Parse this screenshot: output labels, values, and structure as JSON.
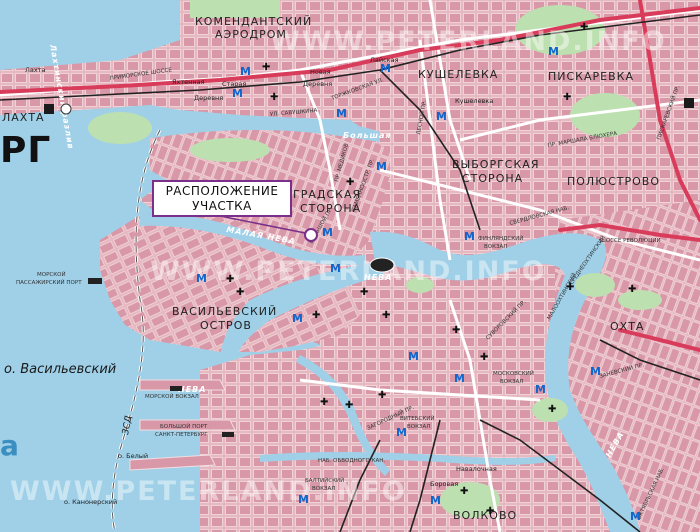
{
  "city_label": "РГ",
  "callout": {
    "line1": "РАСПОЛОЖЕНИЕ",
    "line2": "УЧАСТКА"
  },
  "watermark": "WWW.PETERLAND.INFO",
  "districts": {
    "komendantsky": "КОМЕНДАНТСКИЙ",
    "aerodrom": "АЭРОДРОМ",
    "kusheleveka": "КУШЕЛЕВКА",
    "piskarevka": "ПИСКАРЕВКА",
    "vyborg1": "ВЫБОРГСКАЯ",
    "vyborg2": "СТОРОНА",
    "polyustrovo": "ПОЛЮСТРОВО",
    "petrograd1": "ГРАДСКАЯ",
    "petrograd2": "СТОРОНА",
    "vasil1": "ВАСИЛЬЕВСКИЙ",
    "vasil2": "ОСТРОВ",
    "okhta": "ОХТА",
    "volkovo": "ВОЛКОВО",
    "lakhta": "ЛАХТА",
    "lakhta_top": "Лахта"
  },
  "places": {
    "yakhtennaya": "Яхтенная",
    "staraya1": "Старая",
    "staraya2": "Деревня",
    "novaya1": "Новая",
    "novaya2": "Деревня",
    "kushelevka": "Кушелевка",
    "laiskaya": "Лайская"
  },
  "islands": {
    "vasilievsky": "о. Васильевский",
    "bely": "о. Белый",
    "kanonersky": "о. Канонерский"
  },
  "water": {
    "neva1": "НЕВА",
    "neva2": "НЕВА",
    "neva3": "НЕВА",
    "malaya_neva": "МАЛАЯ НЕВА",
    "bolshaya": "Большая",
    "lakhtinsky": "Лахтинский разлив",
    "gulf": "а"
  },
  "labels": {
    "morskoy_port1": "МОРСКОЙ",
    "morskoy_port2": "ПАССАЖИРСКИЙ ПОРТ",
    "morskoy_vokzal": "МОРСКОЙ ВОКЗАЛ",
    "bolshoy_port1": "БОЛЬШОЙ ПОРТ",
    "bolshoy_port2": "САНКТ-ПЕТЕРБУРГ",
    "finland_vokzal1": "ФИНЛЯНДСКИЙ",
    "finland_vokzal2": "ВОКЗАЛ",
    "moscow_vokzal1": "МОСКОВСКИЙ",
    "moscow_vokzal2": "ВОКЗАЛ",
    "vitebsk_vokzal1": "ВИТЕБСКИЙ",
    "vitebsk_vokzal2": "ВОКЗАЛ",
    "baltic_vokzal1": "БАЛТИЙСКИЙ",
    "baltic_vokzal2": "ВОКЗАЛ",
    "zsd": "ЗСД",
    "primorskoe": "ПРИМОРСКОЕ ШОССЕ",
    "toriko": "ТОРЖКОВСКАЯ УЛ.",
    "savushkina": "УЛ. САВУШКИНА",
    "marshala": "ПР. МАРШАЛА БЛЮХЕРА",
    "sverdlovskaya": "СВЕРДЛОВСКАЯ НАБ.",
    "revolution": "ШОССЕ РЕВОЛЮЦИИ",
    "obvodny": "НАБ. ОБВОДНОГО КАН.",
    "zagorodny": "ЗАГОРОДНЫЙ ПР.",
    "suvorovsky": "СУВОРОВСКИЙ ПР.",
    "zanevsky": "ЗАНЕВСКИЙ ПР.",
    "borovaya": "Боровая",
    "navalochnaya": "Навалочная",
    "bolshoy_pr": "БОЛЬШОЙ ПР.",
    "kamennoostr": "КАМЕННООСТР. ПР.",
    "medikov": "ПР. МЕДИКОВ",
    "sveaborgskaya": "СРЕДНЕОХТИНСКИЙ",
    "lesnoy": "ЛЕСНОЙ ПР.",
    "piskarevsky": "ПИСКАРЕВСКИЙ ПР.",
    "oktyabrskaya": "ОКТЯБРЬСКАЯ НАБ.",
    "malookhtinsky": "МАЛООХТИНСКИЙ"
  },
  "metro_symbol": "M",
  "church_symbol": "✚",
  "colors": {
    "water": "#9fd0e8",
    "land": "#e6b8c0",
    "block": "#d998a8",
    "park": "#bde0b0",
    "road_main": "#ffffff",
    "road_red": "#d83c5a",
    "rail": "#222222",
    "metro": "#1166cc",
    "callout_border": "#7a2f8a"
  }
}
